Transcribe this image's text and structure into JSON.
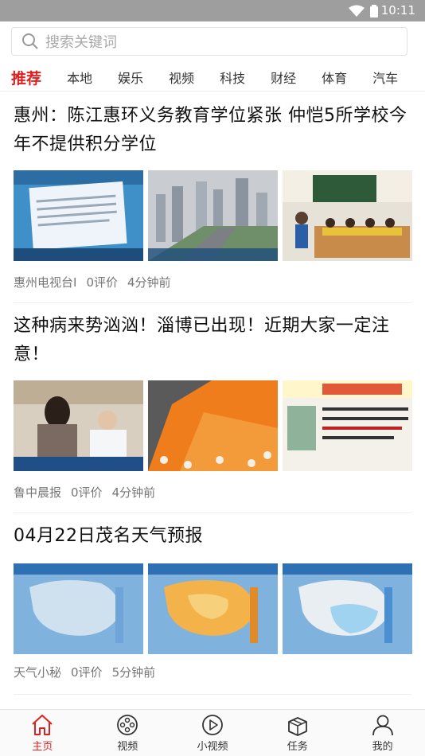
{
  "status_bar": {
    "time": "10:11"
  },
  "search": {
    "placeholder": "搜索关键词"
  },
  "tabs": [
    {
      "label": "推荐",
      "active": true
    },
    {
      "label": "本地"
    },
    {
      "label": "娱乐"
    },
    {
      "label": "视频"
    },
    {
      "label": "科技"
    },
    {
      "label": "财经"
    },
    {
      "label": "体育"
    },
    {
      "label": "汽车"
    }
  ],
  "articles": [
    {
      "title": "惠州：陈江惠环义务教育学位紧张 仲恺5所学校今年不提供积分学位",
      "source": "惠州电视台I",
      "comments": "0评价",
      "time": "4分钟前"
    },
    {
      "title": "这种病来势汹汹！淄博已出现！近期大家一定注意！",
      "source": "鲁中晨报",
      "comments": "0评价",
      "time": "4分钟前"
    },
    {
      "title": "04月22日茂名天气预报",
      "source": "天气小秘",
      "comments": "0评价",
      "time": "5分钟前"
    }
  ],
  "bottom_nav": [
    {
      "label": "主页",
      "icon": "home-icon",
      "active": true
    },
    {
      "label": "视频",
      "icon": "film-reel-icon"
    },
    {
      "label": "小视频",
      "icon": "play-circle-icon"
    },
    {
      "label": "任务",
      "icon": "gift-box-icon"
    },
    {
      "label": "我的",
      "icon": "user-icon"
    }
  ],
  "colors": {
    "accent": "#e02020",
    "status_bar": "#9e9e9e"
  }
}
